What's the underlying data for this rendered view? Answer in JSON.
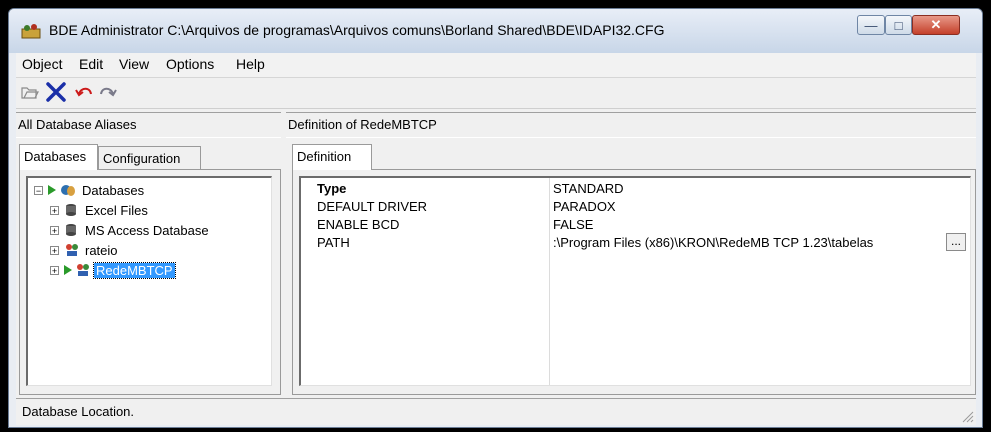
{
  "window": {
    "title": "BDE Administrator  C:\\Arquivos de programas\\Arquivos comuns\\Borland Shared\\BDE\\IDAPI32.CFG"
  },
  "menu": [
    "Object",
    "Edit",
    "View",
    "Options",
    "Help"
  ],
  "toolbar": {
    "icons": [
      "open-icon",
      "delete-icon",
      "undo-icon",
      "redo-icon"
    ]
  },
  "left_header": "All Database Aliases",
  "right_header": "Definition of RedeMBTCP",
  "left_tabs": [
    "Databases",
    "Configuration"
  ],
  "right_tabs": [
    "Definition"
  ],
  "tree": {
    "root": "Databases",
    "items": [
      "Excel Files",
      "MS Access Database",
      "rateio",
      "RedeMBTCP"
    ],
    "selected": "RedeMBTCP"
  },
  "definition": [
    {
      "name": "Type",
      "value": "STANDARD"
    },
    {
      "name": "DEFAULT DRIVER",
      "value": "PARADOX"
    },
    {
      "name": "ENABLE BCD",
      "value": "FALSE"
    },
    {
      "name": "PATH",
      "value": ":\\Program Files (x86)\\KRON\\RedeMB TCP 1.23\\tabelas"
    }
  ],
  "ellipsis_label": "...",
  "status": "Database Location.",
  "colors": {
    "selection": "#3399ff",
    "delete_icon": "#1a2fa8",
    "undo_icon": "#cc1a1a"
  }
}
